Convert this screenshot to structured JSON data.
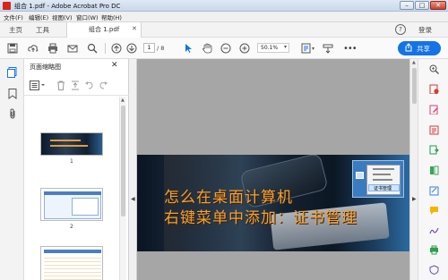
{
  "window": {
    "title": "组合 1.pdf - Adobe Acrobat Pro DC",
    "controls": [
      "minimize",
      "maximize",
      "close"
    ]
  },
  "menu": [
    "文件(F)",
    "编辑(E)",
    "视图(V)",
    "窗口(W)",
    "帮助(H)"
  ],
  "tabs": {
    "home": "主页",
    "tools": "工具",
    "document": "组合 1.pdf",
    "help_icon": "?",
    "login": "登录"
  },
  "toolbar": {
    "page_current": "1",
    "page_total": "/ 8",
    "zoom": "50.1%",
    "share_label": "共享"
  },
  "panel": {
    "title": "页面缩略图",
    "thumbnails": [
      {
        "number": "1"
      },
      {
        "number": "2"
      }
    ]
  },
  "document": {
    "banner_line1": "怎么在桌面计算机",
    "banner_line2": "右键菜单中添加：证书管理",
    "context_menu_item": "证书管理"
  },
  "colors": {
    "accent_blue": "#1473e6",
    "banner_text": "#f2a13a"
  }
}
